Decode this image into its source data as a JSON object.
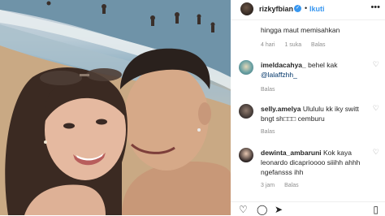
{
  "header": {
    "username": "rizkyfbian",
    "separator": "•",
    "follow_label": "Ikuti",
    "verified_glyph": "✓",
    "more_icon": "more-horizontal-icon"
  },
  "comments": [
    {
      "username": "",
      "text": "hingga maut memisahkan",
      "time": "4 hari",
      "likes": "1 suka",
      "reply": "Balas"
    },
    {
      "username": "imeldacahya_",
      "text": "behel kak",
      "mention": "@lalaffzhh_",
      "time": "",
      "likes": "",
      "reply": "Balas"
    },
    {
      "username": "selly.amelya",
      "text": "Ulululu kk iky switt bngt sh□□□ cemburu",
      "time": "",
      "likes": "",
      "reply": "Balas"
    },
    {
      "username": "dewinta_ambaruni",
      "text": "Kok kaya leonardo dicaprioooo siiihh ahhh ngefansss ihh",
      "time": "3 jam",
      "likes": "",
      "reply": "Balas"
    }
  ],
  "colors": {
    "accent": "#3897f0",
    "muted": "#8e8e8e",
    "mention": "#003569",
    "text": "#262626"
  },
  "actions": {
    "like_icon": "heart-icon",
    "comment_icon": "comment-icon",
    "share_icon": "send-icon",
    "save_icon": "bookmark-icon"
  }
}
